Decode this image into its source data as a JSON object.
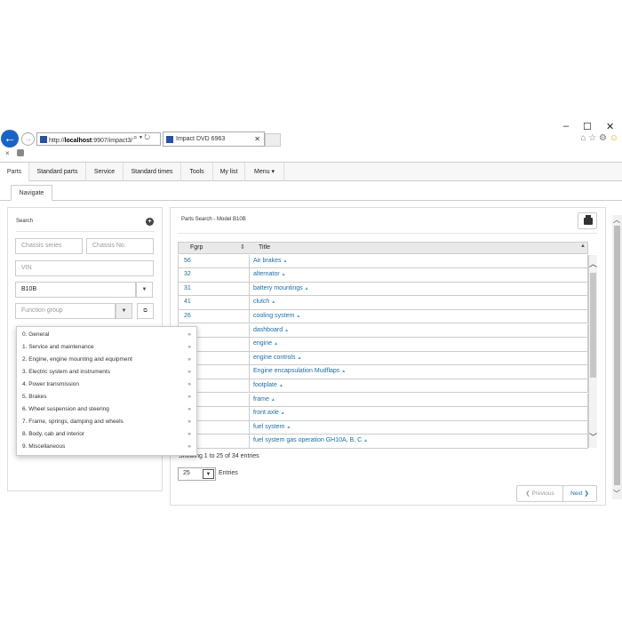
{
  "window": {
    "minimize": "–",
    "maximize": "☐",
    "close": "✕"
  },
  "browser": {
    "url_prefix": "http://",
    "url_host": "localhost",
    "url_rest": ":9907/impact3/",
    "url_tools": "⌕ ▾ ↻",
    "tab_title": "Impact DVD 6963",
    "tab_close": "✕",
    "fav_close": "×",
    "icons": [
      "home-icon",
      "star-icon",
      "gear-icon",
      "smiley-icon"
    ]
  },
  "nav": {
    "items": [
      "Parts",
      "Standard parts",
      "Service",
      "Standard times",
      "Tools",
      "My list",
      "Menu ▾"
    ]
  },
  "subtab": "Navigate",
  "search": {
    "title": "Search",
    "chassis_series_placeholder": "Chassis series",
    "chassis_no_placeholder": "Chassis No.",
    "vin_placeholder": "VIN",
    "model_value": "B10B",
    "function_group_placeholder": "Function group"
  },
  "function_groups": [
    "0. General",
    "1. Service and maintenance",
    "2. Engine, engine mounting and equipment",
    "3. Electric system and instruments",
    "4. Power transmission",
    "5. Brakes",
    "6. Wheel suspension and steering",
    "7. Frame, springs, damping and wheels",
    "8. Body, cab and interior",
    "9. Miscellaneous"
  ],
  "results": {
    "title": "Parts Search - Model B10B",
    "col_fgrp": "Fgrp",
    "col_title": "Title",
    "rows": [
      {
        "fgrp": "56",
        "title": "Air brakes"
      },
      {
        "fgrp": "32",
        "title": "alternator"
      },
      {
        "fgrp": "31",
        "title": "battery mountings"
      },
      {
        "fgrp": "41",
        "title": "clutch"
      },
      {
        "fgrp": "26",
        "title": "cooling system"
      },
      {
        "fgrp": "",
        "title": "dashboard"
      },
      {
        "fgrp": "",
        "title": "engine"
      },
      {
        "fgrp": "",
        "title": "engine controls"
      },
      {
        "fgrp": "",
        "title": "Engine encapsulation Mudflaps"
      },
      {
        "fgrp": "",
        "title": "footplate"
      },
      {
        "fgrp": "",
        "title": "frame"
      },
      {
        "fgrp": "",
        "title": "front axle"
      },
      {
        "fgrp": "",
        "title": "fuel system"
      },
      {
        "fgrp": "",
        "title": "fuel system gas operation GH10A, B, C"
      }
    ],
    "showing": "Showing 1 to 25 of 34 entries",
    "page_length": "25",
    "entries_label": "Entries",
    "prev_label": "Previous",
    "next_label": "Next"
  },
  "colors": {
    "link": "#1a6fa8",
    "back_button": "#1a63c6"
  }
}
